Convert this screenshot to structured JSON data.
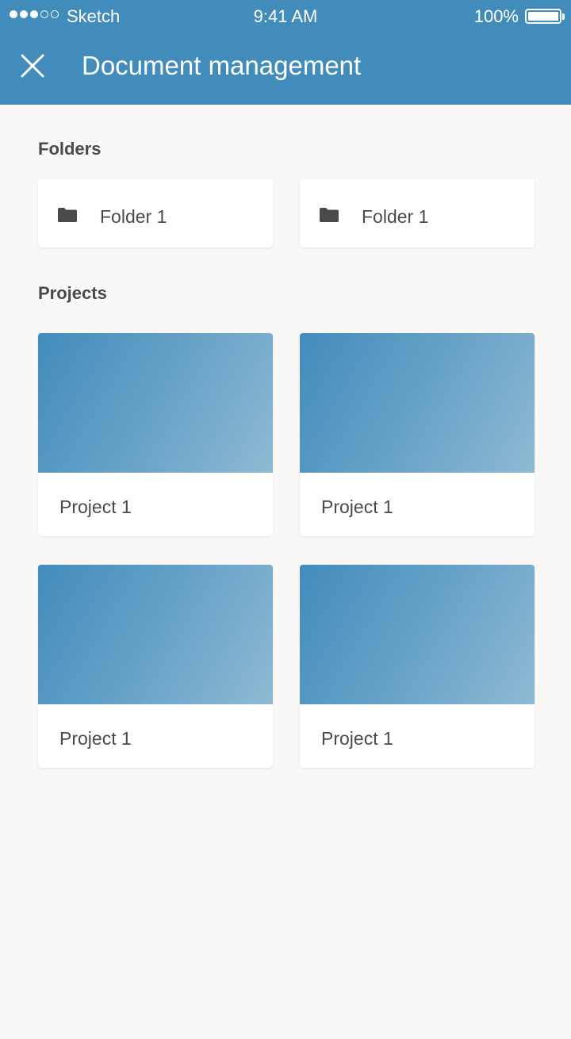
{
  "status_bar": {
    "carrier": "Sketch",
    "time": "9:41 AM",
    "battery": "100%",
    "signal_bars_filled": 3,
    "signal_bars_total": 5
  },
  "header": {
    "title": "Document management",
    "close_icon": "close-icon"
  },
  "folders": {
    "heading": "Folders",
    "items": [
      {
        "label": "Folder 1",
        "icon": "folder-icon"
      },
      {
        "label": "Folder 1",
        "icon": "folder-icon"
      }
    ]
  },
  "projects": {
    "heading": "Projects",
    "items": [
      {
        "label": "Project 1"
      },
      {
        "label": "Project 1"
      },
      {
        "label": "Project 1"
      },
      {
        "label": "Project 1"
      }
    ]
  },
  "colors": {
    "header_bg": "#428cbc",
    "page_bg": "#faf8f7",
    "text": "#4a4a4a"
  }
}
